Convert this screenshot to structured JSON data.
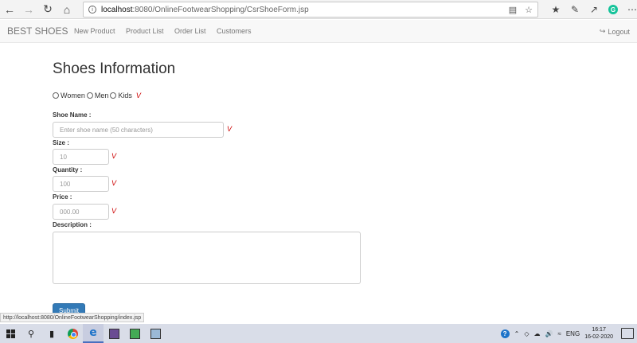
{
  "browser": {
    "url_host": "localhost",
    "url_path": ":8080/OnlineFootwearShopping/CsrShoeForm.jsp",
    "icons": [
      "back-icon",
      "forward-icon",
      "refresh-icon",
      "home-icon",
      "info-icon",
      "reading-view-icon",
      "favorite-star-icon",
      "favorites-hub-icon",
      "pen-icon",
      "share-icon",
      "grammarly-icon",
      "more-icon"
    ],
    "grammarly_letter": "G"
  },
  "navbar": {
    "brand": "BEST SHOES",
    "links": [
      "New Product",
      "Product List",
      "Order List",
      "Customers"
    ],
    "logout": "Logout"
  },
  "form": {
    "title": "Shoes Information",
    "categories": [
      "Women",
      "Men",
      "Kids"
    ],
    "validation_mark": "V",
    "shoe_name_label": "Shoe Name :",
    "shoe_name_placeholder": "Enter shoe name (50 characters)",
    "size_label": "Size :",
    "size_placeholder": "10",
    "quantity_label": "Quantity :",
    "quantity_placeholder": "100",
    "price_label": "Price :",
    "price_placeholder": "000.00",
    "description_label": "Description :",
    "submit_label": "Submit"
  },
  "status_bar": {
    "link_preview": "http://localhost:8080/OnlineFootwearShopping/index.jsp"
  },
  "taskbar": {
    "language": "ENG",
    "time": "16:17",
    "date": "16-02-2020"
  },
  "colors": {
    "primary_button": "#337ab7",
    "validation": "#cc0000",
    "navbar_bg": "#f8f8f8"
  }
}
